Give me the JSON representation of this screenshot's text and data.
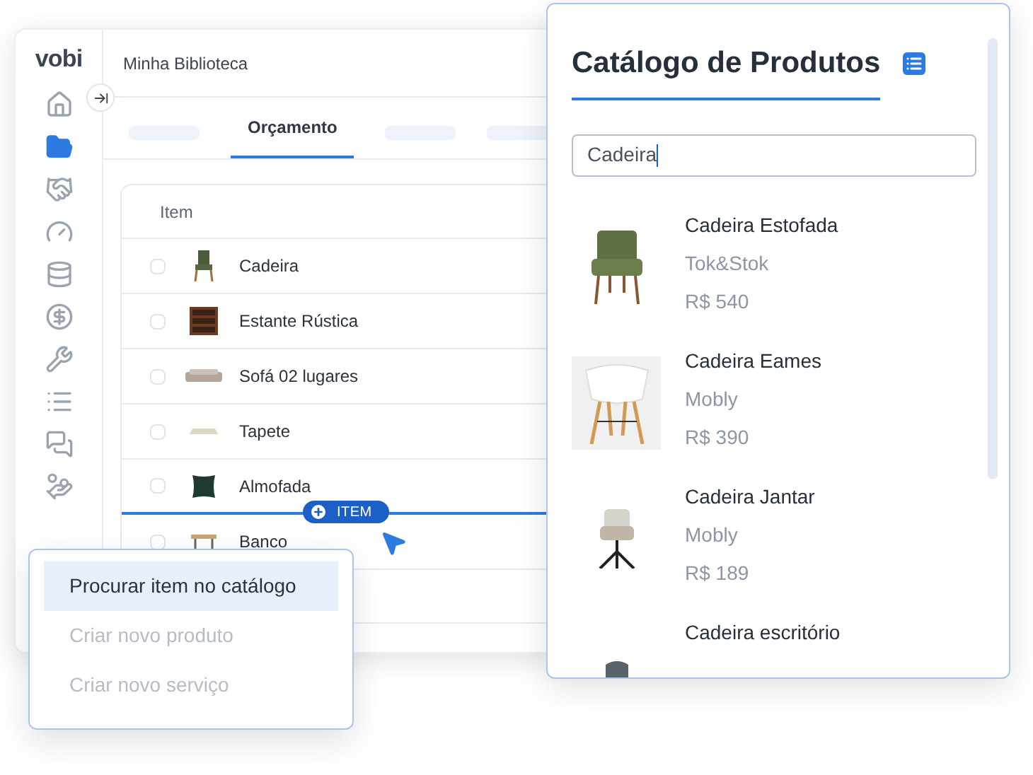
{
  "library": {
    "logo": "vobi",
    "title": "Minha Biblioteca",
    "sidebar": [
      {
        "kind": "home",
        "selected": false
      },
      {
        "kind": "folder",
        "selected": true
      },
      {
        "kind": "handshake",
        "selected": false
      },
      {
        "kind": "gauge",
        "selected": false
      },
      {
        "kind": "coins",
        "selected": false
      },
      {
        "kind": "dollar",
        "selected": false
      },
      {
        "kind": "tools",
        "selected": false
      },
      {
        "kind": "list",
        "selected": false
      },
      {
        "kind": "chat",
        "selected": false
      },
      {
        "kind": "payment",
        "selected": false
      }
    ],
    "tabs": [
      {
        "label": "Orçamento",
        "selected": true
      }
    ],
    "table": {
      "columns": [
        "Item"
      ],
      "rows": [
        {
          "name": "Cadeira",
          "checked": false,
          "kind": "chair"
        },
        {
          "name": "Estante Rústica",
          "checked": false,
          "kind": "shelf"
        },
        {
          "name": "Sofá 02 lugares",
          "checked": false,
          "kind": "sofa"
        },
        {
          "name": "Tapete",
          "checked": false,
          "kind": "rug"
        },
        {
          "name": "Almofada",
          "checked": false,
          "kind": "cushion"
        },
        {
          "name": "Banco",
          "checked": false,
          "kind": "bench"
        }
      ]
    },
    "add_button": "ITEM"
  },
  "menu": [
    {
      "label": "Procurar item no catálogo",
      "selected": true,
      "disabled": false
    },
    {
      "label": "Criar novo produto",
      "selected": false,
      "disabled": true
    },
    {
      "label": "Criar novo serviço",
      "selected": false,
      "disabled": true
    }
  ],
  "catalog": {
    "title": "Catálogo de Produtos",
    "search": {
      "value": "Cadeira"
    },
    "products": [
      {
        "name": "Cadeira Estofada",
        "store": "Tok&Stok",
        "price": "R$ 540",
        "kind": "armchair"
      },
      {
        "name": "Cadeira Eames",
        "store": "Mobly",
        "price": "R$ 390",
        "kind": "eames"
      },
      {
        "name": "Cadeira Jantar",
        "store": "Mobly",
        "price": "R$ 189",
        "kind": "swivel"
      },
      {
        "name": "Cadeira escritório",
        "kind": "office"
      }
    ]
  }
}
